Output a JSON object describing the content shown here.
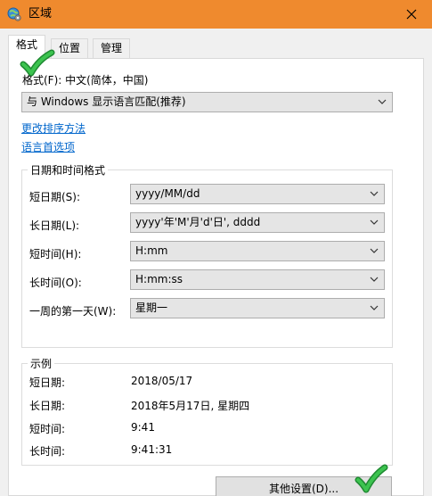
{
  "window": {
    "title": "区域",
    "icons": {
      "app": "globe-settings-icon",
      "close": "close-icon"
    }
  },
  "tabs": [
    "格式",
    "位置",
    "管理"
  ],
  "format": {
    "label": "格式(F): 中文(简体，中国)",
    "selected": "与 Windows 显示语言匹配(推荐)"
  },
  "links": {
    "sort": "更改排序方法",
    "language": "语言首选项"
  },
  "datetime": {
    "title": "日期和时间格式",
    "rows": [
      {
        "label": "短日期(S):",
        "value": "yyyy/MM/dd"
      },
      {
        "label": "长日期(L):",
        "value": "yyyy'年'M'月'd'日', dddd"
      },
      {
        "label": "短时间(H):",
        "value": "H:mm"
      },
      {
        "label": "长时间(O):",
        "value": "H:mm:ss"
      },
      {
        "label": "一周的第一天(W):",
        "value": "星期一"
      }
    ]
  },
  "examples": {
    "title": "示例",
    "rows": [
      {
        "label": "短日期:",
        "value": "2018/05/17"
      },
      {
        "label": "长日期:",
        "value": "2018年5月17日, 星期四"
      },
      {
        "label": "短时间:",
        "value": "9:41"
      },
      {
        "label": "长时间:",
        "value": "9:41:31"
      }
    ]
  },
  "buttons": {
    "other_settings": "其他设置(D)..."
  },
  "colors": {
    "titlebar": "#ef8a2e",
    "link": "#0066cc",
    "checkmark": "#22a33a"
  }
}
